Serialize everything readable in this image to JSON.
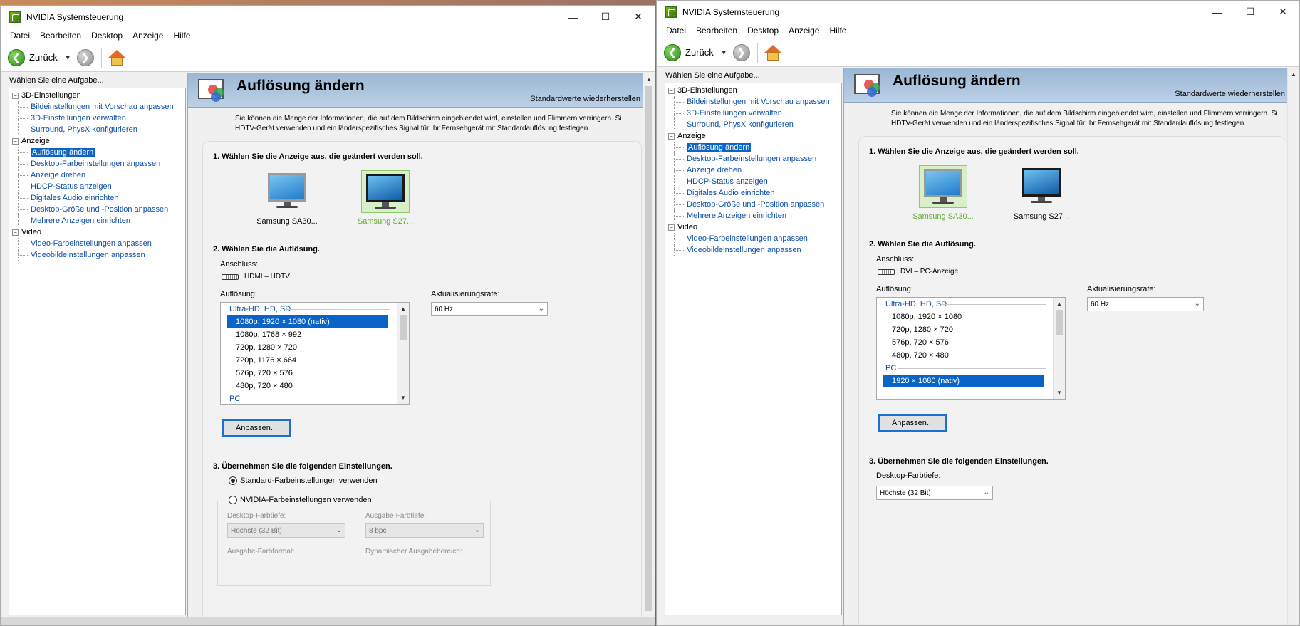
{
  "win1": {
    "title": "NVIDIA Systemsteuerung",
    "menu": [
      "Datei",
      "Bearbeiten",
      "Desktop",
      "Anzeige",
      "Hilfe"
    ],
    "back_label": "Zurück",
    "sidebar_caption": "Wählen Sie eine Aufgabe...",
    "tree": {
      "cat1": "3D-Einstellungen",
      "cat1_items": [
        "Bildeinstellungen mit Vorschau anpassen",
        "3D-Einstellungen verwalten",
        "Surround, PhysX konfigurieren"
      ],
      "cat2": "Anzeige",
      "cat2_items": [
        "Auflösung ändern",
        "Desktop-Farbeinstellungen anpassen",
        "Anzeige drehen",
        "HDCP-Status anzeigen",
        "Digitales Audio einrichten",
        "Desktop-Größe und -Position anpassen",
        "Mehrere Anzeigen einrichten"
      ],
      "cat3": "Video",
      "cat3_items": [
        "Video-Farbeinstellungen anpassen",
        "Videobildeinstellungen anpassen"
      ]
    },
    "page_title": "Auflösung ändern",
    "restore": "Standardwerte wiederherstellen",
    "intro_1": "Sie können die Menge der Informationen, die auf dem Bildschirm eingeblendet wird, einstellen und Flimmern verringern. Si",
    "intro_2": "HDTV-Gerät verwenden und ein länderspezifisches Signal für Ihr Fernsehgerät mit Standardauflösung festlegen.",
    "s1": "1. Wählen Sie die Anzeige aus, die geändert werden soll.",
    "mon1": "Samsung SA30...",
    "mon2": "Samsung S27...",
    "s2": "2. Wählen Sie die Auflösung.",
    "conn_label": "Anschluss:",
    "conn_value": "HDMI – HDTV",
    "res_label": "Auflösung:",
    "group_hd": "Ultra-HD, HD, SD",
    "res_rows": [
      "1080p, 1920 × 1080 (nativ)",
      "1080p, 1768 × 992",
      "720p, 1280 × 720",
      "720p, 1176 × 664",
      "576p, 720 × 576",
      "480p, 720 × 480"
    ],
    "group_pc": "PC",
    "refresh_label": "Aktualisierungsrate:",
    "refresh_value": "60 Hz",
    "customize": "Anpassen...",
    "s3": "3. Übernehmen Sie die folgenden Einstellungen.",
    "radio1": "Standard-Farbeinstellungen verwenden",
    "radio2": "NVIDIA-Farbeinstellungen verwenden",
    "depth_label": "Desktop-Farbtiefe:",
    "depth_value": "Höchste (32 Bit)",
    "out_depth_label": "Ausgabe-Farbtiefe:",
    "out_depth_value": "8 bpc",
    "out_format_label": "Ausgabe-Farbformat:",
    "dyn_range_label": "Dynamischer Ausgabebereich:"
  },
  "win2": {
    "title": "NVIDIA Systemsteuerung",
    "menu": [
      "Datei",
      "Bearbeiten",
      "Desktop",
      "Anzeige",
      "Hilfe"
    ],
    "back_label": "Zurück",
    "sidebar_caption": "Wählen Sie eine Aufgabe...",
    "tree": {
      "cat1": "3D-Einstellungen",
      "cat1_items": [
        "Bildeinstellungen mit Vorschau anpassen",
        "3D-Einstellungen verwalten",
        "Surround, PhysX konfigurieren"
      ],
      "cat2": "Anzeige",
      "cat2_items": [
        "Auflösung ändern",
        "Desktop-Farbeinstellungen anpassen",
        "Anzeige drehen",
        "HDCP-Status anzeigen",
        "Digitales Audio einrichten",
        "Desktop-Größe und -Position anpassen",
        "Mehrere Anzeigen einrichten"
      ],
      "cat3": "Video",
      "cat3_items": [
        "Video-Farbeinstellungen anpassen",
        "Videobildeinstellungen anpassen"
      ]
    },
    "page_title": "Auflösung ändern",
    "restore": "Standardwerte wiederherstellen",
    "intro_1": "Sie können die Menge der Informationen, die auf dem Bildschirm eingeblendet wird, einstellen und Flimmern verringern. Si",
    "intro_2": "HDTV-Gerät verwenden und ein länderspezifisches Signal für Ihr Fernsehgerät mit Standardauflösung festlegen.",
    "s1": "1. Wählen Sie die Anzeige aus, die geändert werden soll.",
    "mon1": "Samsung SA30...",
    "mon2": "Samsung S27...",
    "s2": "2. Wählen Sie die Auflösung.",
    "conn_label": "Anschluss:",
    "conn_value": "DVI – PC-Anzeige",
    "res_label": "Auflösung:",
    "group_hd": "Ultra-HD, HD, SD",
    "res_rows_hd": [
      "1080p, 1920 × 1080",
      "720p, 1280 × 720",
      "576p, 720 × 576",
      "480p, 720 × 480"
    ],
    "group_pc": "PC",
    "res_rows_pc": [
      "1920 × 1080 (nativ)"
    ],
    "refresh_label": "Aktualisierungsrate:",
    "refresh_value": "60 Hz",
    "customize": "Anpassen...",
    "s3": "3. Übernehmen Sie die folgenden Einstellungen.",
    "depth_label": "Desktop-Farbtiefe:",
    "depth_value": "Höchste (32 Bit)"
  }
}
